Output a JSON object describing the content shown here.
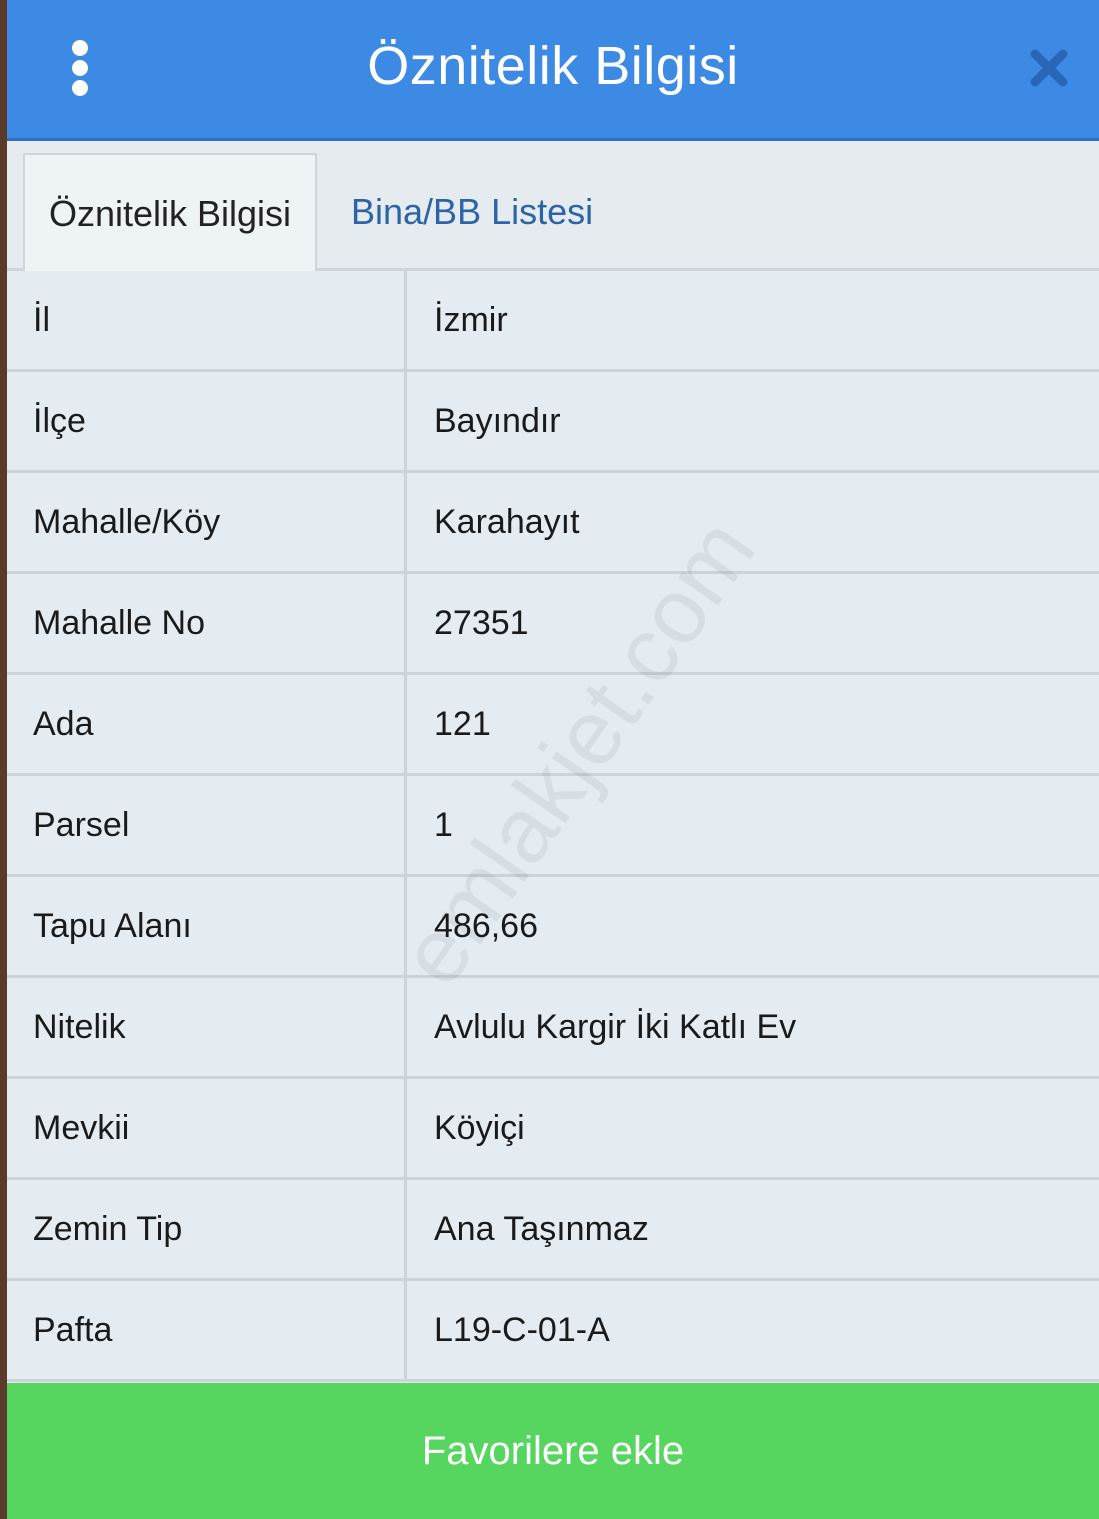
{
  "header": {
    "title": "Öznitelik Bilgisi",
    "menu_icon": "vertical-dots-icon",
    "close_icon": "close-x-icon",
    "background_color": "#3d8ae4"
  },
  "tabs": [
    {
      "label": "Öznitelik Bilgisi",
      "active": true
    },
    {
      "label": "Bina/BB Listesi",
      "active": false
    }
  ],
  "attributes": [
    {
      "label": "İl",
      "value": "İzmir"
    },
    {
      "label": "İlçe",
      "value": "Bayındır"
    },
    {
      "label": "Mahalle/Köy",
      "value": "Karahayıt"
    },
    {
      "label": "Mahalle No",
      "value": "27351"
    },
    {
      "label": "Ada",
      "value": "121"
    },
    {
      "label": "Parsel",
      "value": "1"
    },
    {
      "label": "Tapu Alanı",
      "value": "486,66"
    },
    {
      "label": "Nitelik",
      "value": "Avlulu Kargir İki Katlı Ev"
    },
    {
      "label": "Mevkii",
      "value": "Köyiçi"
    },
    {
      "label": "Zemin Tip",
      "value": "Ana Taşınmaz"
    },
    {
      "label": "Pafta",
      "value": "L19-C-01-A"
    }
  ],
  "footer": {
    "favorite_label": "Favorilere ekle",
    "button_color": "#56d65e"
  },
  "watermark": "emlakjet.com"
}
